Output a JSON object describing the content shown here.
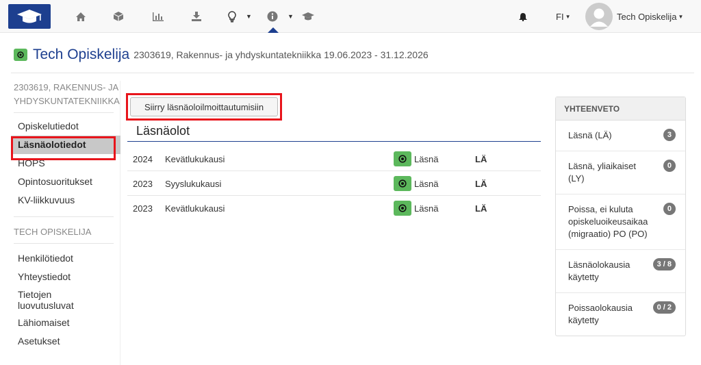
{
  "nav": {
    "language": "FI",
    "user_name": "Tech Opiskelija",
    "icons": [
      "home-icon",
      "cube-icon",
      "bar-chart-icon",
      "download-icon",
      "lightbulb-icon",
      "info-icon",
      "graduation-cap-icon",
      "bell-icon"
    ]
  },
  "header": {
    "name": "Tech Opiskelija",
    "details": "2303619, Rakennus- ja yhdyskuntatekniikka 19.06.2023 - 31.12.2026"
  },
  "sidebar": {
    "program_title": "2303619, RAKENNUS- JA YHDYSKUNTATEKNIIKKA",
    "study_items": [
      "Opiskelutiedot",
      "Läsnäolotiedot",
      "HOPS",
      "Opintosuoritukset",
      "KV-liikkuvuus"
    ],
    "user_title": "TECH OPISKELIJA",
    "user_items": [
      "Henkilötiedot",
      "Yhteystiedot",
      "Tietojen luovutusluvat",
      "Lähiomaiset",
      "Asetukset"
    ]
  },
  "main": {
    "move_button": "Siirry läsnäoloilmoittautumisiin",
    "title": "Läsnäolot",
    "rows": [
      {
        "year": "2024",
        "term": "Kevätlukukausi",
        "status": "Läsnä",
        "code": "LÄ"
      },
      {
        "year": "2023",
        "term": "Syyslukukausi",
        "status": "Läsnä",
        "code": "LÄ"
      },
      {
        "year": "2023",
        "term": "Kevätlukukausi",
        "status": "Läsnä",
        "code": "LÄ"
      }
    ]
  },
  "summary": {
    "title": "YHTEENVETO",
    "items": [
      {
        "label": "Läsnä (LÄ)",
        "value": "3"
      },
      {
        "label": "Läsnä, yliaikaiset (LY)",
        "value": "0"
      },
      {
        "label": "Poissa, ei kuluta opiskeluoikeusaikaa (migraatio) PO (PO)",
        "value": "0"
      },
      {
        "label": "Läsnäolokausia käytetty",
        "value": "3 / 8"
      },
      {
        "label": "Poissaolokausia käytetty",
        "value": "0 / 2"
      }
    ]
  },
  "colors": {
    "brand": "#1d3f8f",
    "success": "#5cb85c",
    "highlight": "#e8141b"
  }
}
